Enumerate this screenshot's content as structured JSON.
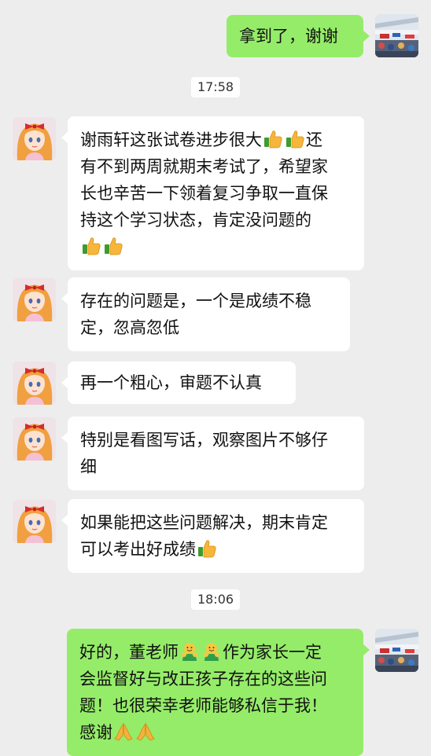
{
  "messages": {
    "m1": {
      "lines": [
        "拿到了，谢谢"
      ]
    },
    "time1": "17:58",
    "m2": {
      "lines": [
        "谢雨轩这张试卷进步很大",
        "还",
        "有不到两周就期末考试了，希望家",
        "长也辛苦一下领着复习争取一直保",
        "持这个学习状态，肯定没问题的"
      ]
    },
    "m3": {
      "lines": [
        "存在的问题是，一个是成绩不稳",
        "定，忽高忽低"
      ]
    },
    "m4": {
      "lines": [
        "再一个粗心，审题不认真"
      ]
    },
    "m5": {
      "lines": [
        "特别是看图写话，观察图片不够仔",
        "细"
      ]
    },
    "m6": {
      "lines": [
        "如果能把这些问题解决，期末肯定",
        "可以考出好成绩"
      ]
    },
    "time2": "18:06",
    "m7": {
      "lines": [
        "好的，董老师",
        "作为家长一定",
        "会监督好与改正孩子存在的这些问",
        "题！也很荣幸老师能够私信于我！",
        "感谢"
      ]
    }
  },
  "icons": {
    "thumbs_up": "thumbs-up-emoji",
    "hug": "hug-emoji",
    "pray": "pray-emoji",
    "teacher_avatar": "teacher-avatar-anime-girl",
    "parent_avatar": "parent-avatar-photo"
  },
  "colors": {
    "background": "#ededed",
    "incoming_bubble": "#ffffff",
    "outgoing_bubble": "#95ec69"
  }
}
